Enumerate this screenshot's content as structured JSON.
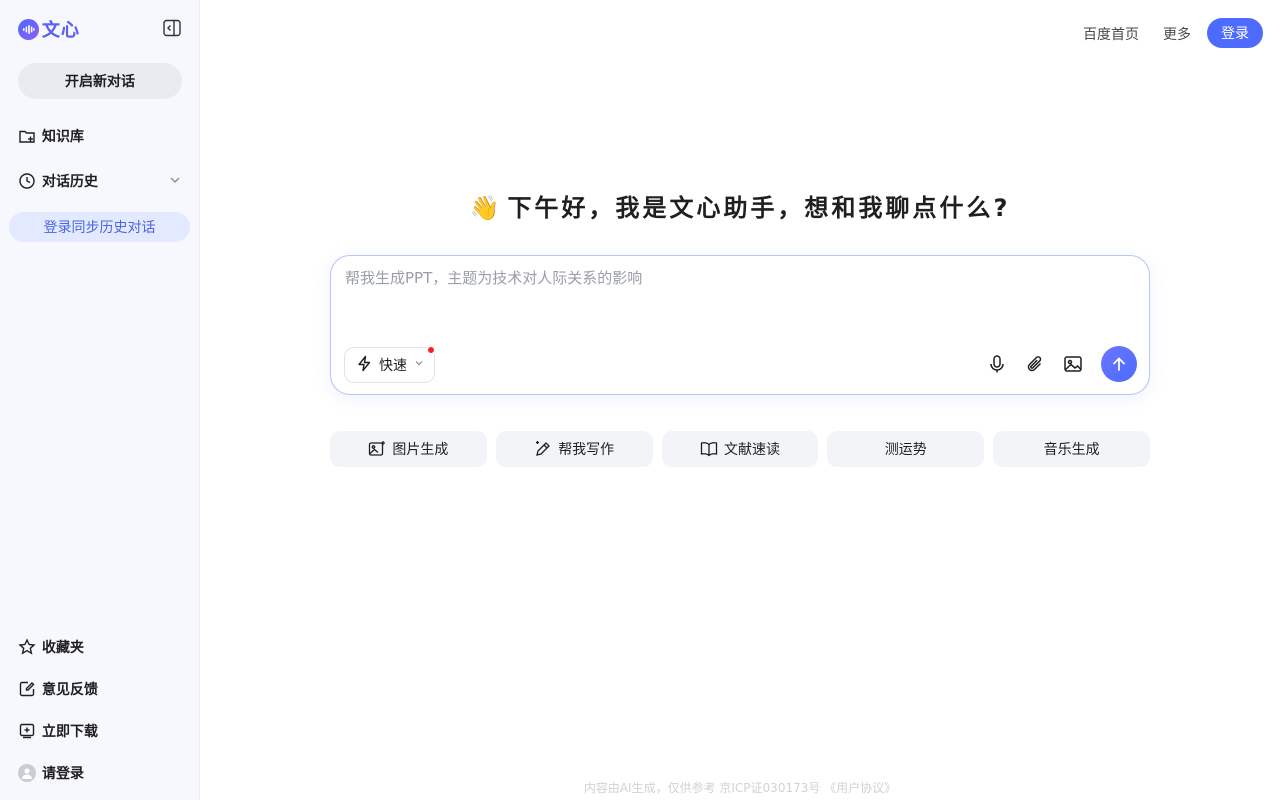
{
  "brand": {
    "logo_text": "文心"
  },
  "sidebar": {
    "new_chat_label": "开启新对话",
    "knowledge_label": "知识库",
    "history_label": "对话历史",
    "sync_label": "登录同步历史对话",
    "favorites_label": "收藏夹",
    "feedback_label": "意见反馈",
    "download_label": "立即下载",
    "login_label": "请登录"
  },
  "header": {
    "home_link": "百度首页",
    "more_link": "更多",
    "login_button": "登录"
  },
  "main": {
    "greeting_emoji": "👋",
    "greeting": "下午好，我是文心助手，想和我聊点什么?",
    "input_placeholder": "帮我生成PPT，主题为技术对人际关系的影响",
    "mode_label": "快速",
    "chips": [
      {
        "label": "图片生成",
        "icon": "image-plus-icon"
      },
      {
        "label": "帮我写作",
        "icon": "pen-icon"
      },
      {
        "label": "文献速读",
        "icon": "book-icon"
      },
      {
        "label": "测运势",
        "icon": ""
      },
      {
        "label": "音乐生成",
        "icon": ""
      }
    ]
  },
  "footer": {
    "text": "内容由AI生成，仅供参考   京ICP证030173号  《用户协议》"
  },
  "colors": {
    "accent": "#4d6bfe",
    "sidebar_bg": "#f6f8fd",
    "sync_bg": "#e3eaff"
  }
}
